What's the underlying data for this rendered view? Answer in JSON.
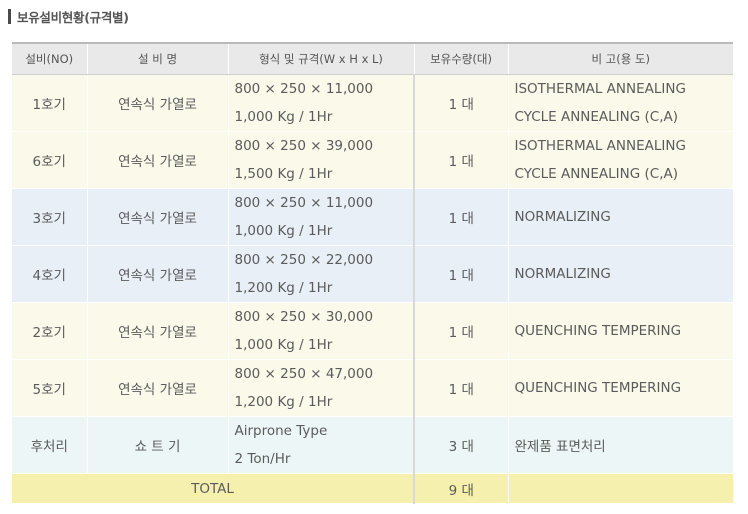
{
  "section": {
    "title": "보유설비현황(규격별)"
  },
  "table": {
    "headers": [
      "설비(NO)",
      "설 비 명",
      "형식 및 규격(W x H x L)",
      "보유수량(대)",
      "비 고(용 도)"
    ],
    "rows": [
      {
        "no": "1호기",
        "name": "연속식 가열로",
        "spec1": "800 × 250 × 11,000",
        "spec2": "1,000 Kg / 1Hr",
        "qty": "1 대",
        "note1": "ISOTHERMAL ANNEALING",
        "note2": "CYCLE ANNEALING (C,A)"
      },
      {
        "no": "6호기",
        "name": "연속식 가열로",
        "spec1": "800 × 250 × 39,000",
        "spec2": "1,500 Kg / 1Hr",
        "qty": "1 대",
        "note1": "ISOTHERMAL ANNEALING",
        "note2": "CYCLE ANNEALING (C,A)"
      },
      {
        "no": "3호기",
        "name": "연속식 가열로",
        "spec1": "800 × 250 × 11,000",
        "spec2": "1,000 Kg / 1Hr",
        "qty": "1 대",
        "note1": "NORMALIZING",
        "note2": ""
      },
      {
        "no": "4호기",
        "name": "연속식 가열로",
        "spec1": "800 × 250 × 22,000",
        "spec2": "1,200 Kg / 1Hr",
        "qty": "1 대",
        "note1": "NORMALIZING",
        "note2": ""
      },
      {
        "no": "2호기",
        "name": "연속식 가열로",
        "spec1": "800 × 250 × 30,000",
        "spec2": "1,000 Kg / 1Hr",
        "qty": "1 대",
        "note1": "QUENCHING TEMPERING",
        "note2": ""
      },
      {
        "no": "5호기",
        "name": "연속식 가열로",
        "spec1": "800 × 250 × 47,000",
        "spec2": "1,200 Kg / 1Hr",
        "qty": "1 대",
        "note1": "QUENCHING TEMPERING",
        "note2": ""
      },
      {
        "no": "후처리",
        "name": "쇼 트 기",
        "spec1": "Airprone Type",
        "spec2": "2 Ton/Hr",
        "qty": "3 대",
        "note1": "완제품 표면처리",
        "note2": ""
      }
    ],
    "total": {
      "label": "TOTAL",
      "qty": "9 대"
    }
  }
}
